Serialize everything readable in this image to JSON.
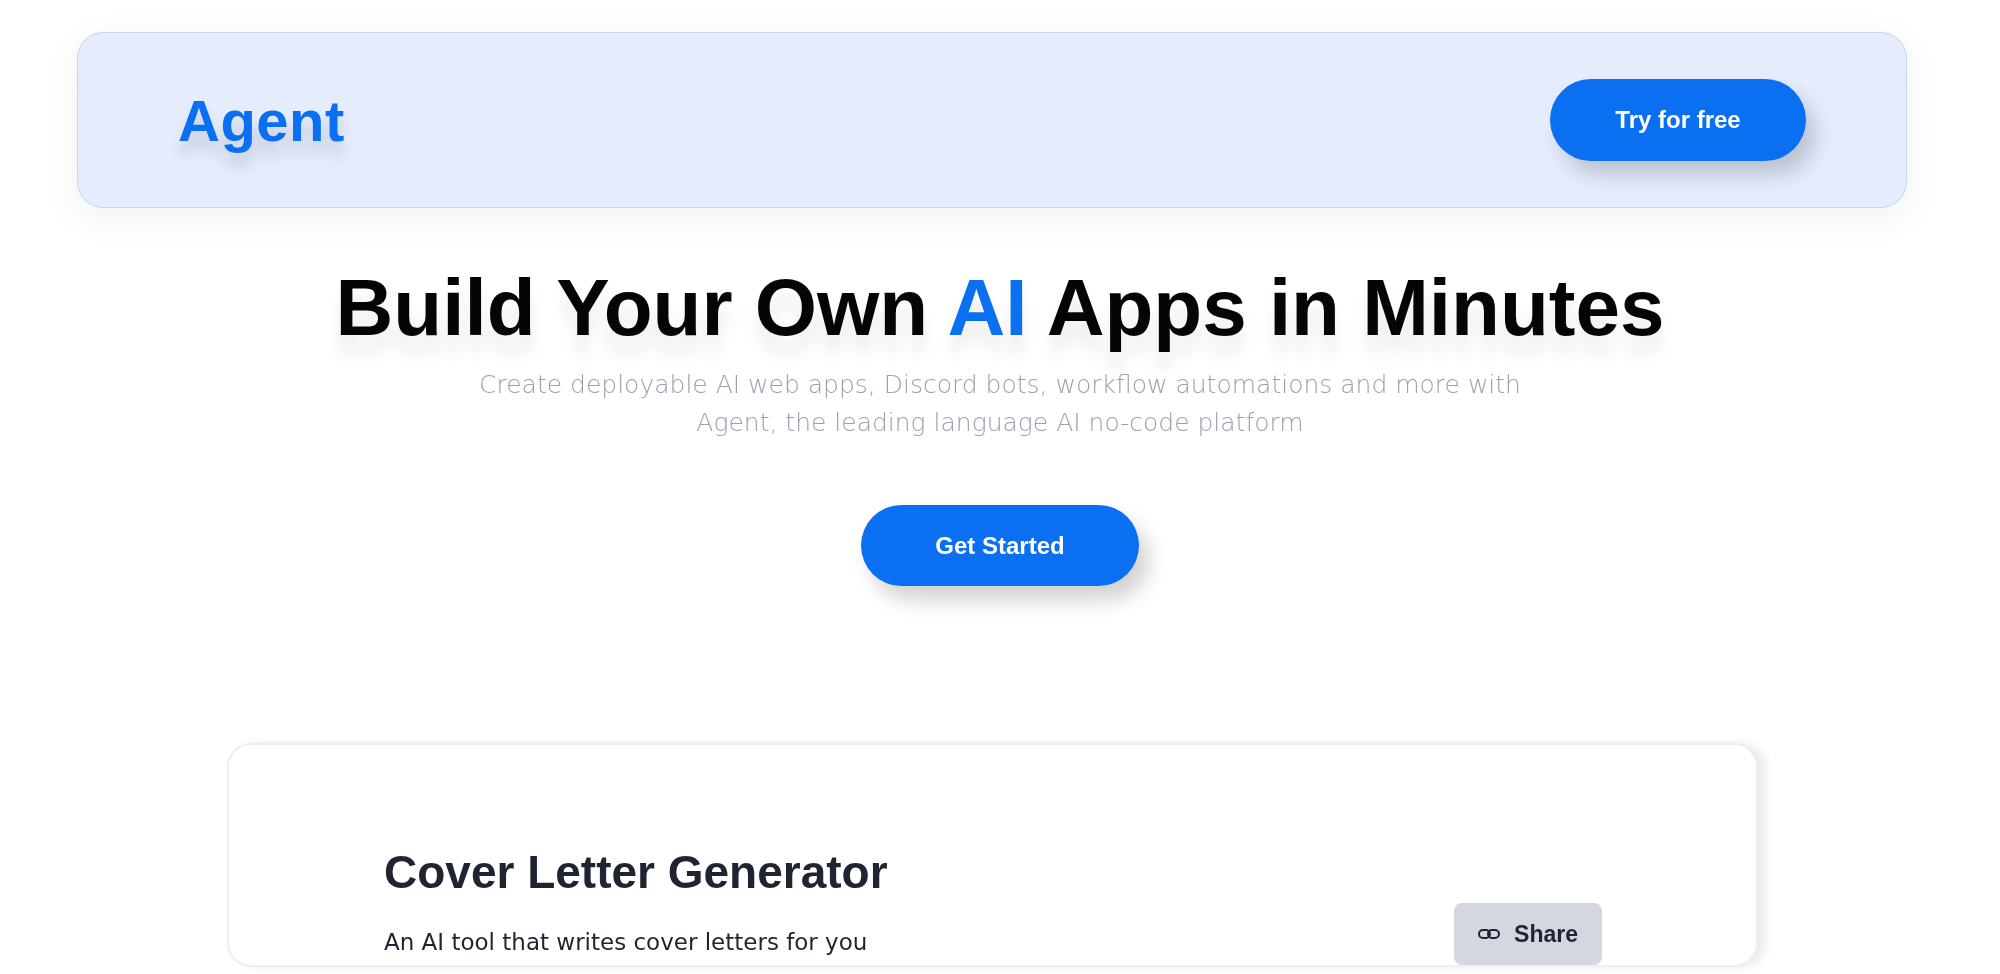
{
  "header": {
    "logo": "Agent",
    "button": "Try for free"
  },
  "hero": {
    "headline": [
      {
        "text": "Build Your Own ",
        "accent": false
      },
      {
        "text": "AI",
        "accent": true
      },
      {
        "text": " Apps in Minutes",
        "accent": false
      }
    ],
    "subtitle": "Create deployable AI web apps, Discord bots, workflow automations and more with Agent, the leading language AI no-code platform",
    "button": "Get Started"
  },
  "card": {
    "title": "Cover Letter Generator",
    "description": "An AI tool that writes cover letters for you",
    "share_button": "Share"
  }
}
